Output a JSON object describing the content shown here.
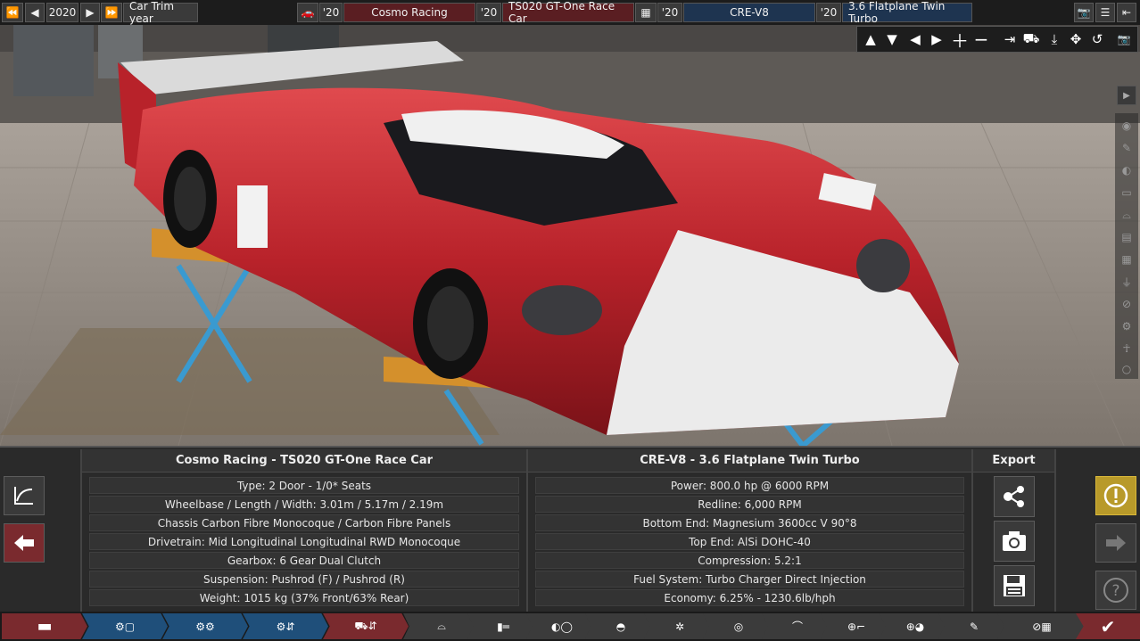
{
  "topbar": {
    "year": "2020",
    "trim_year_label": "Car Trim year",
    "car_year": "'20",
    "company": "Cosmo Racing",
    "model_year": "'20",
    "model": "TS020 GT-One Race Car",
    "engine_year": "'20",
    "engine_family": "CRE-V8",
    "variant_year": "'20",
    "variant": "3.6 Flatplane Twin Turbo"
  },
  "car_panel": {
    "title": "Cosmo Racing - TS020 GT-One Race Car",
    "rows": [
      "Type: 2 Door - 1/0* Seats",
      "Wheelbase / Length / Width: 3.01m / 5.17m / 2.19m",
      "Chassis Carbon Fibre Monocoque / Carbon Fibre Panels",
      "Drivetrain: Mid Longitudinal Longitudinal RWD Monocoque",
      "Gearbox: 6 Gear Dual Clutch",
      "Suspension: Pushrod (F) / Pushrod (R)",
      "Weight: 1015 kg (37% Front/63% Rear)"
    ]
  },
  "engine_panel": {
    "title": "CRE-V8 - 3.6 Flatplane Twin Turbo",
    "rows": [
      "Power: 800.0 hp @ 6000 RPM",
      "Redline:  6,000 RPM",
      "Bottom End: Magnesium 3600cc V 90°8",
      "Top End: AlSi DOHC-40",
      "Compression: 5.2:1",
      "Fuel System: Turbo Charger Direct Injection",
      "Economy: 6.25% - 1230.6lb/hph"
    ]
  },
  "export": {
    "title": "Export"
  },
  "colors": {
    "accent_red": "#7a2a2e",
    "accent_blue": "#1f4f7a",
    "warning": "#b89a2a",
    "car_red": "#c4262c"
  }
}
